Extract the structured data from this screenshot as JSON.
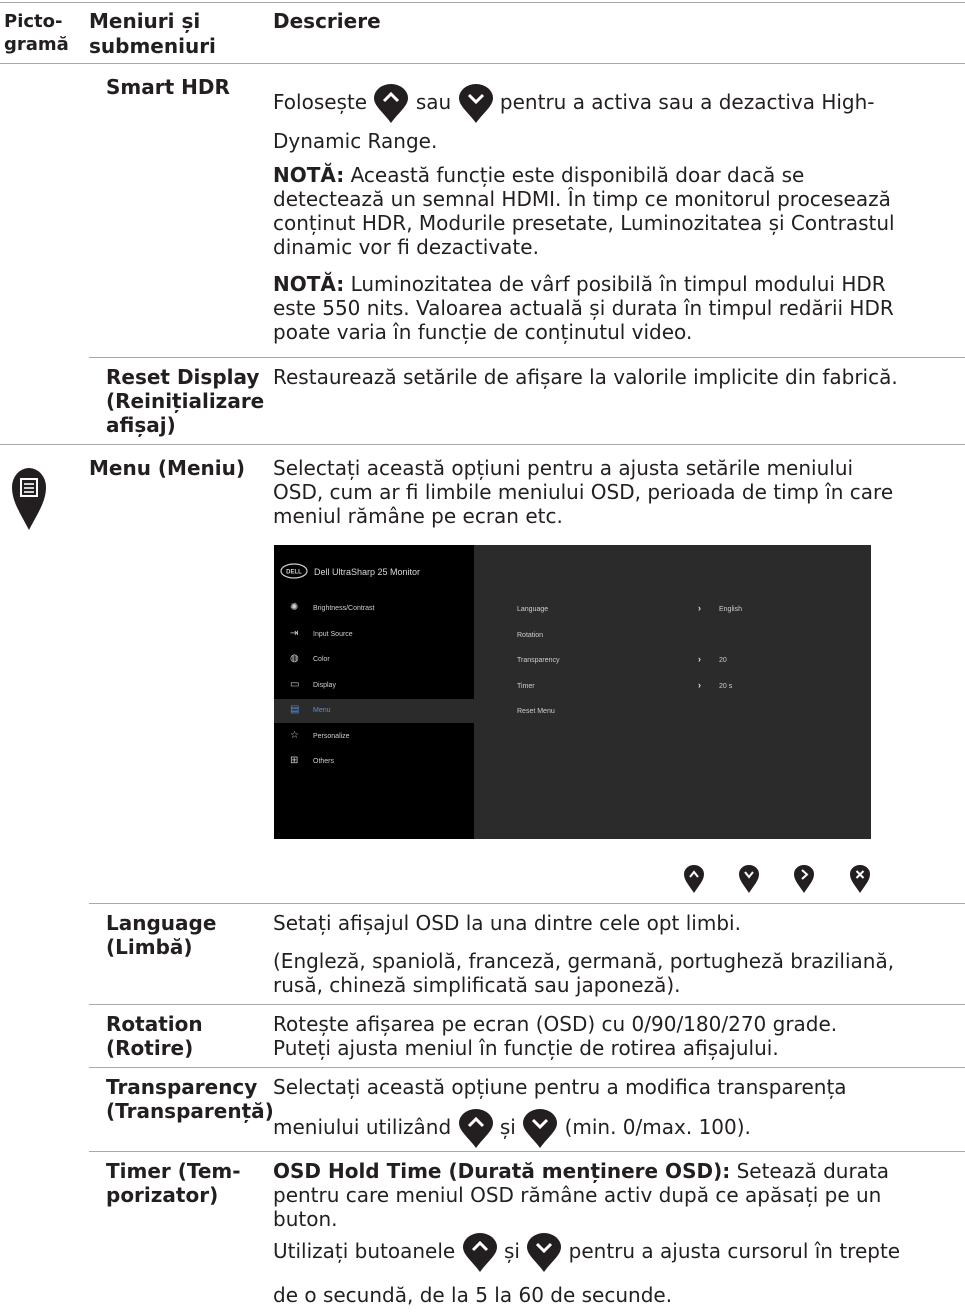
{
  "header": {
    "col1": [
      "Picto-",
      "gramă"
    ],
    "col2": [
      "Meniuri și",
      "submeniuri"
    ],
    "col3": "Descriere"
  },
  "smart_hdr": {
    "name": "Smart HDR",
    "desc1_a": "Folosește",
    "desc1_b": "sau",
    "desc1_c": "pentru a activa sau a dezactiva High-",
    "desc1_d": "Dynamic Range.",
    "note1_label": "NOTĂ:",
    "note1_lines": [
      " Această funcție este disponibilă doar dacă se",
      "detectează un semnal HDMI. În timp ce monitorul procesează",
      "conținut HDR, Modurile presetate, Luminozitatea și Contrastul",
      "dinamic vor fi dezactivate."
    ],
    "note2_label": "NOTĂ:",
    "note2_lines": [
      " Luminozitatea de vârf posibilă în timpul modului HDR",
      "este 550 nits. Valoarea actuală și durata în timpul redării HDR",
      "poate varia în funcție de conținutul video."
    ]
  },
  "reset_display": {
    "name_lines": [
      "Reset Display",
      "(Reinițializare",
      "afișaj)"
    ],
    "desc": "Restaurează setările de afișare la valorile implicite din fabrică."
  },
  "menu": {
    "name": "Menu (Meniu)",
    "desc_lines": [
      "Selectați această opțiuni pentru a ajusta setările meniului",
      "OSD, cum ar fi limbile meniului OSD, perioada de timp în care",
      "meniul rămâne pe ecran etc."
    ]
  },
  "osd": {
    "brand": "DELL",
    "title": "Dell UltraSharp 25 Monitor",
    "items": [
      "Brightness/Contrast",
      "Input Source",
      "Color",
      "Display",
      "Menu",
      "Personalize",
      "Others"
    ],
    "rows": [
      {
        "label": "Language",
        "value": "English"
      },
      {
        "label": "Rotation",
        "value": ""
      },
      {
        "label": "Transparency",
        "value": "20"
      },
      {
        "label": "Timer",
        "value": "20 s"
      },
      {
        "label": "Reset Menu",
        "value": ""
      }
    ]
  },
  "language": {
    "name_lines": [
      "Language",
      "(Limbă)"
    ],
    "desc1": "Setați afișajul OSD la una dintre cele opt limbi.",
    "desc2_lines": [
      "(Engleză, spaniolă, franceză, germană, portugheză braziliană,",
      "rusă, chineză simplificată sau japoneză)."
    ]
  },
  "rotation": {
    "name_lines": [
      "Rotation",
      "(Rotire)"
    ],
    "desc_lines": [
      "Rotește afișarea pe ecran (OSD) cu 0/90/180/270 grade.",
      "Puteți ajusta meniul în funcție de rotirea afișajului."
    ]
  },
  "transparency": {
    "name_lines": [
      "Transparency",
      "(Transparență)"
    ],
    "desc1": "Selectați această opțiune pentru a modifica transparența",
    "desc2_a": "meniului utilizând",
    "desc2_b": "și",
    "desc2_c": "(min. 0/max. 100)."
  },
  "timer": {
    "name_lines": [
      "Timer (Tem-",
      "porizator)"
    ],
    "hold_label": "OSD Hold Time (Durată menținere OSD):",
    "hold_rest": " Setează durata",
    "lines": [
      "pentru care meniul OSD rămâne activ după ce apăsați pe un",
      "buton."
    ],
    "use_a": "Utilizați butoanele",
    "use_b": "și",
    "use_c": "pentru a ajusta cursorul în trepte",
    "use_d": "de o secundă, de la 5 la 60 de secunde."
  },
  "colors": {
    "rule": "#a7a9ac",
    "text": "#231f20",
    "drop": "#231f20"
  }
}
